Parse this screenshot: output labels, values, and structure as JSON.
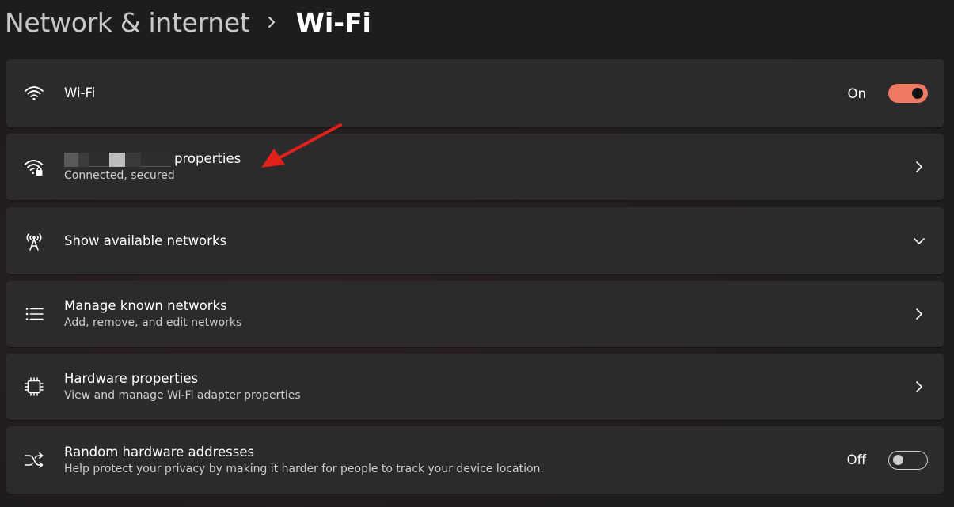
{
  "breadcrumb": {
    "parent": "Network & internet",
    "current": "Wi-Fi"
  },
  "wifi_toggle": {
    "title": "Wi-Fi",
    "state_label": "On",
    "enabled": true,
    "icon": "wifi-icon"
  },
  "connected_network": {
    "title_suffix": "properties",
    "status": "Connected, secured",
    "icon": "wifi-secured-icon",
    "name_redacted": true
  },
  "available_networks": {
    "title": "Show available networks",
    "icon": "antenna-icon"
  },
  "known_networks": {
    "title": "Manage known networks",
    "subtitle": "Add, remove, and edit networks",
    "icon": "list-icon"
  },
  "hardware_properties": {
    "title": "Hardware properties",
    "subtitle": "View and manage Wi-Fi adapter properties",
    "icon": "chip-icon"
  },
  "random_addresses": {
    "title": "Random hardware addresses",
    "subtitle": "Help protect your privacy by making it harder for people to track your device location.",
    "state_label": "Off",
    "enabled": false,
    "icon": "shuffle-icon"
  },
  "colors": {
    "toggle_on": "#ee7a62",
    "card_bg": "#2c2a2c",
    "annotation_arrow": "#e0201b"
  }
}
